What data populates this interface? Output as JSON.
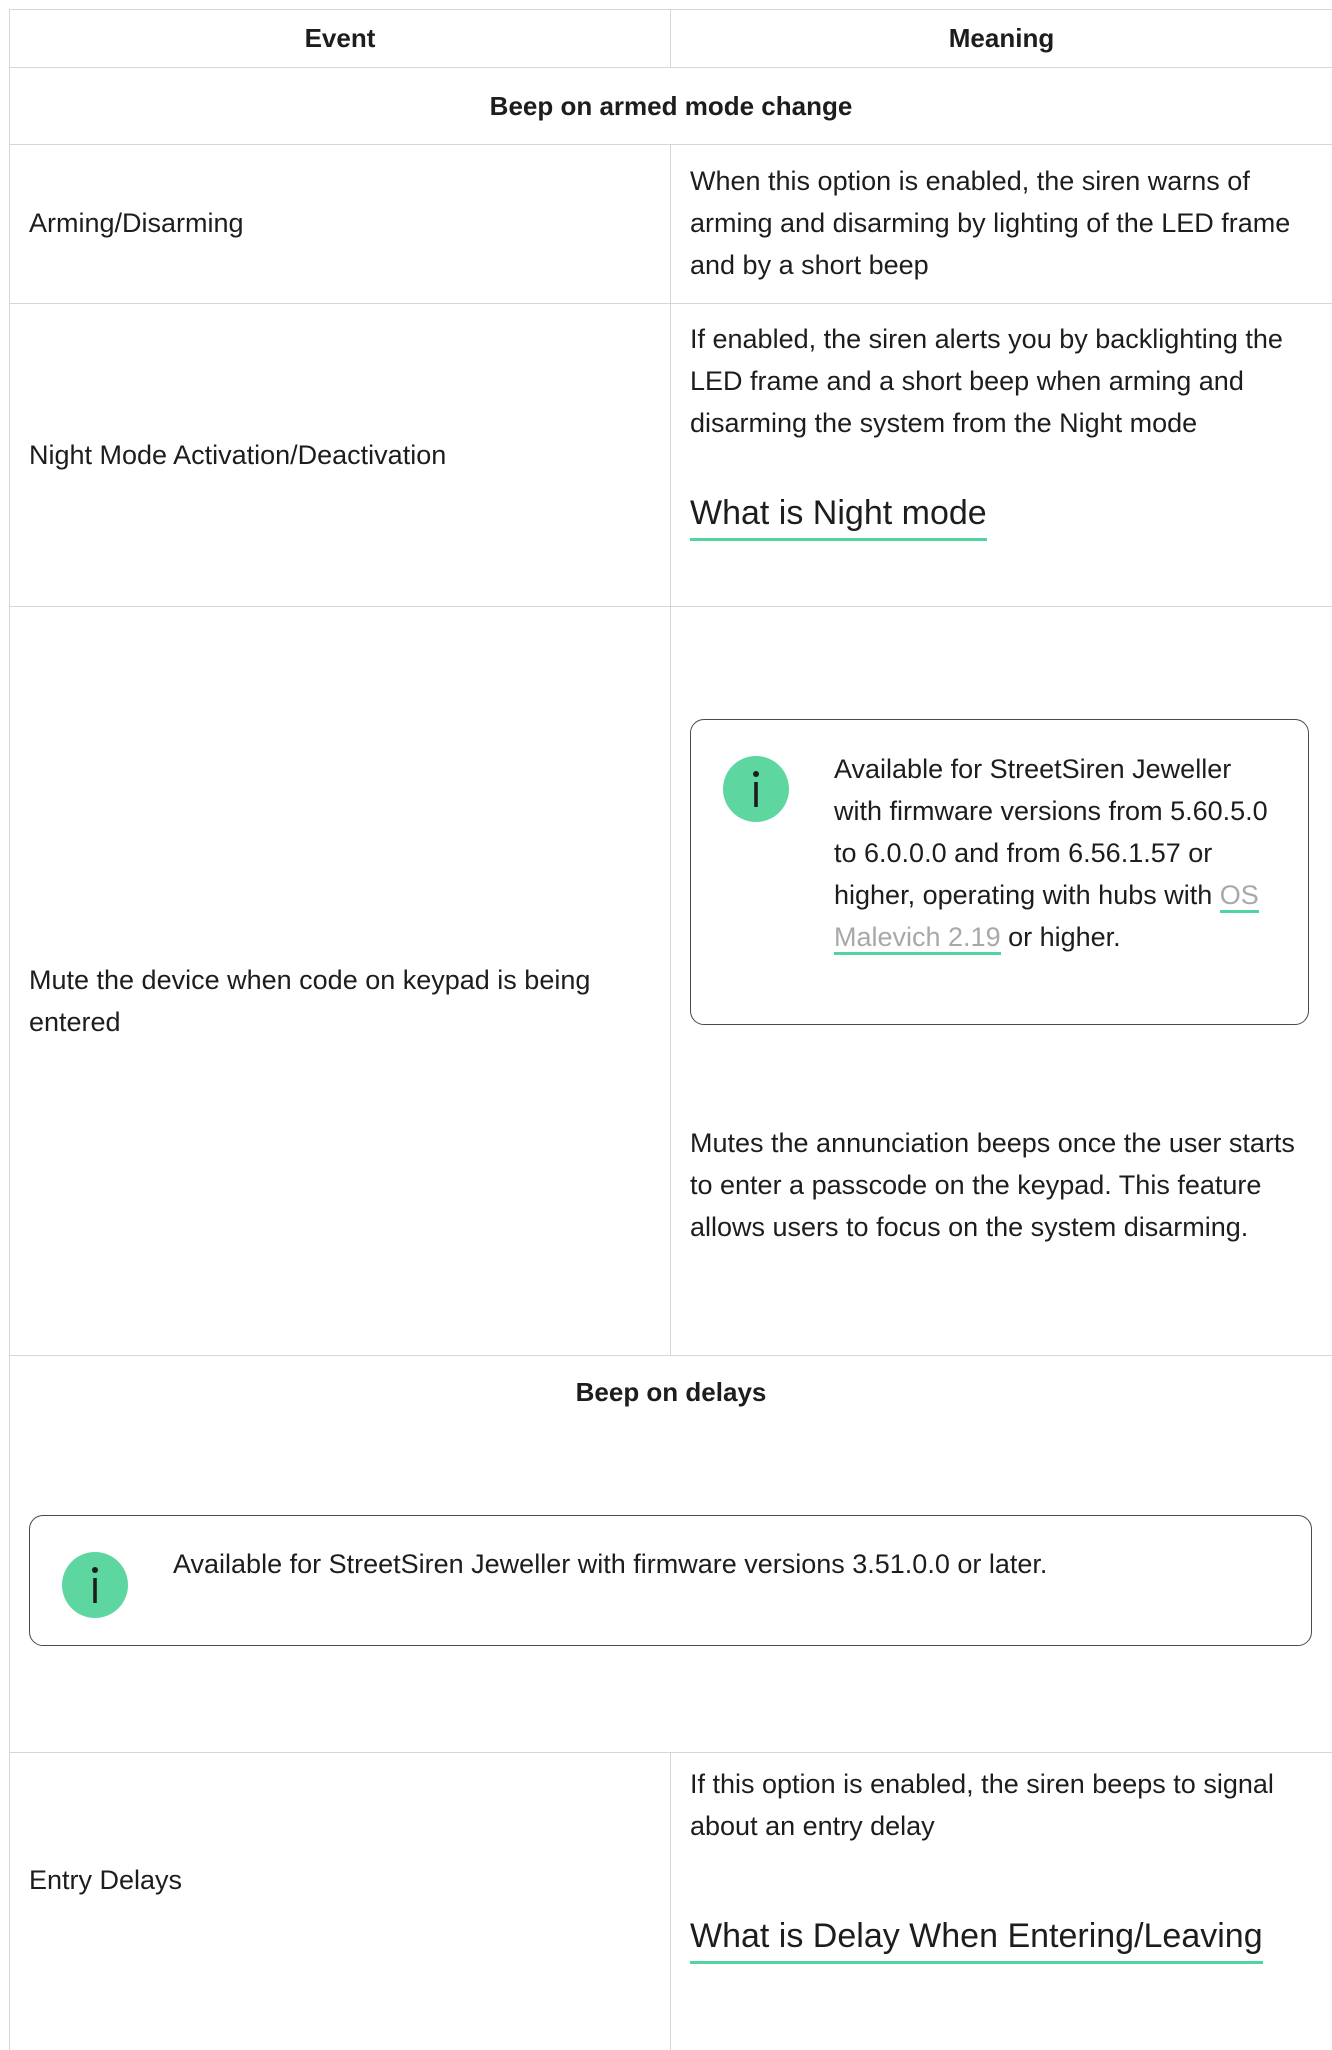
{
  "header": {
    "event": "Event",
    "meaning": "Meaning"
  },
  "groups": {
    "armed": "Beep on armed mode change",
    "delays": "Beep on delays"
  },
  "rows": {
    "arming": {
      "event": "Arming/Disarming",
      "meaning": "When this option is enabled, the siren warns of arming and disarming by lighting of the LED frame and by a short beep"
    },
    "night": {
      "event": "Night Mode Activation/Deactivation",
      "meaning": "If enabled, the siren alerts you by backlighting the LED frame and a short beep when arming and disarming the system from the Night mode",
      "link": "What is Night mode"
    },
    "mute": {
      "event": "Mute the device when code on keypad is being entered",
      "note_before": "Available for StreetSiren Jeweller with firmware versions from 5.60.5.0 to 6.0.0.0 and from 6.56.1.57 or higher, operating with hubs with ",
      "note_link": "OS Malevich 2.19",
      "note_after": " or higher.",
      "meaning": "Mutes the annunciation beeps once the user starts to enter a passcode on the keypad. This feature allows users to focus on the system disarming."
    },
    "delays_note": "Available for StreetSiren Jeweller with firmware versions 3.51.0.0 or later.",
    "entry": {
      "event": "Entry Delays",
      "meaning": "If this option is enabled, the siren beeps to signal about an entry delay",
      "link": "What is Delay When Entering/Leaving"
    }
  },
  "colors": {
    "accent": "#5ed6a0",
    "border": "#d6d6d6",
    "muted_link": "#a8a8a8"
  },
  "icons": {
    "note": "info-icon"
  }
}
